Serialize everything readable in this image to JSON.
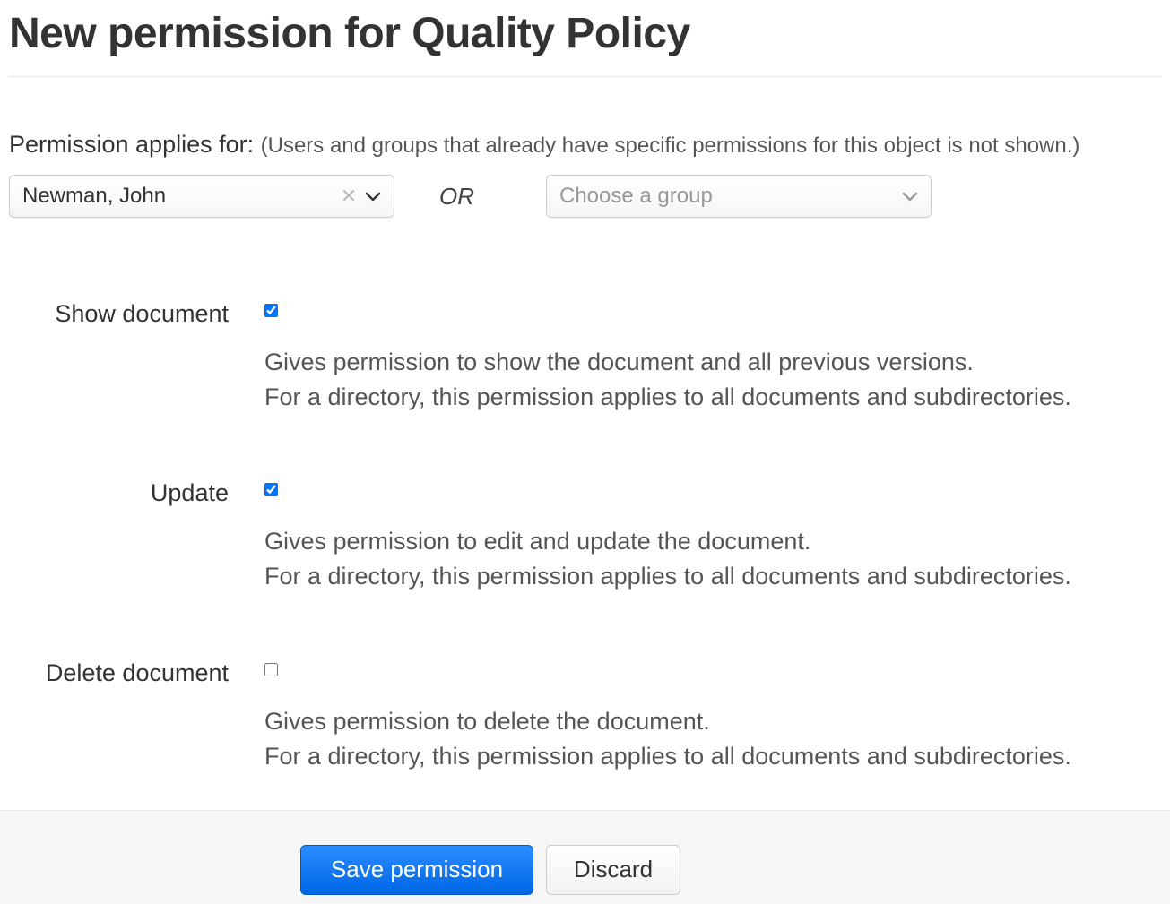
{
  "header": {
    "title": "New permission for Quality Policy"
  },
  "applies": {
    "label": "Permission applies for: ",
    "hint": "(Users and groups that already have specific permissions for this object is not shown.)",
    "user_value": "Newman, John",
    "or_label": "OR",
    "group_placeholder": "Choose a group"
  },
  "permissions": [
    {
      "label": "Show document",
      "checked": true,
      "desc_line1": "Gives permission to show the document and all previous versions.",
      "desc_line2": "For a directory, this permission applies to all documents and subdirectories."
    },
    {
      "label": "Update",
      "checked": true,
      "desc_line1": "Gives permission to edit and update the document.",
      "desc_line2": "For a directory, this permission applies to all documents and subdirectories."
    },
    {
      "label": "Delete document",
      "checked": false,
      "desc_line1": "Gives permission to delete the document.",
      "desc_line2": "For a directory, this permission applies to all documents and subdirectories."
    }
  ],
  "footer": {
    "save_label": "Save permission",
    "discard_label": "Discard"
  }
}
